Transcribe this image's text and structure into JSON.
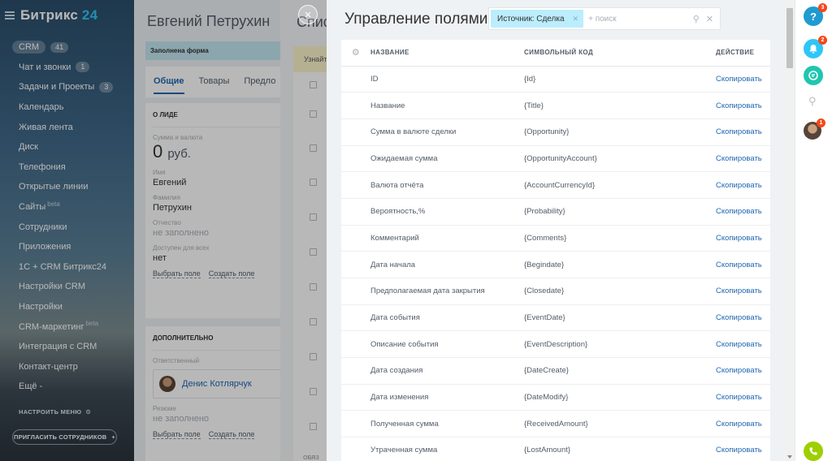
{
  "sidebar": {
    "logo_prefix": "Битрикс",
    "logo_suffix": "24",
    "crm": {
      "label": "CRM",
      "count": "41"
    },
    "items": [
      {
        "label": "Чат и звонки",
        "count": "1"
      },
      {
        "label": "Задачи и Проекты",
        "count": "3"
      },
      {
        "label": "Календарь"
      },
      {
        "label": "Живая лента"
      },
      {
        "label": "Диск"
      },
      {
        "label": "Телефония"
      },
      {
        "label": "Открытые линии"
      },
      {
        "label": "Сайты",
        "sup": "beta"
      },
      {
        "label": "Сотрудники"
      },
      {
        "label": "Приложения"
      },
      {
        "label": "1С + CRM Битрикс24"
      },
      {
        "label": "Настройки CRM"
      },
      {
        "label": "Настройки"
      },
      {
        "label": "CRM-маркетинг",
        "sup": "beta"
      },
      {
        "label": "Интеграция с CRM"
      },
      {
        "label": "Контакт-центр"
      },
      {
        "label": "Ещё -"
      }
    ],
    "settings_menu": "НАСТРОИТЬ МЕНЮ",
    "invite": "ПРИГЛАСИТЬ СОТРУДНИКОВ"
  },
  "contact_card": {
    "title": "Евгений Петрухин",
    "form_bar": "Заполнена форма",
    "tabs": [
      "Общие",
      "Товары",
      "Предло"
    ],
    "about": {
      "section": "О ЛИДЕ",
      "amount_label": "Сумма и валюта",
      "amount_value": "0",
      "amount_currency": "руб.",
      "name_label": "Имя",
      "name_value": "Евгений",
      "lastname_label": "Фамилия",
      "lastname_value": "Петрухин",
      "middle_label": "Отчество",
      "middle_value": "не заполнено",
      "available_label": "Доступен для всех",
      "available_value": "нет",
      "select_field": "Выбрать поле",
      "create_field": "Создать поле"
    },
    "extra": {
      "section": "ДОПОЛНИТЕЛЬНО",
      "responsible_label": "Ответственный",
      "responsible_name": "Денис Котлярчук",
      "resume_label": "Резюме",
      "resume_value": "не заполнено",
      "select_field": "Выбрать поле",
      "create_field": "Создать поле"
    }
  },
  "mid_layer": {
    "title": "Спис",
    "bar_text": "Узнайт",
    "footer": "ОБЯЗ"
  },
  "panel": {
    "title": "Управление полями",
    "filter": {
      "chip": "Источник: Сделка",
      "placeholder": "+ поиск"
    },
    "columns": [
      "НАЗВАНИЕ",
      "СИМВОЛЬНЫЙ КОД",
      "ДЕЙСТВИЕ"
    ],
    "rows": [
      {
        "name": "ID",
        "code": "{Id}",
        "action": "Скопировать"
      },
      {
        "name": "Название",
        "code": "{Title}",
        "action": "Скопировать"
      },
      {
        "name": "Сумма в валюте сделки",
        "code": "{Opportunity}",
        "action": "Скопировать"
      },
      {
        "name": "Ожидаемая сумма",
        "code": "{OpportunityAccount}",
        "action": "Скопировать"
      },
      {
        "name": "Валюта отчёта",
        "code": "{AccountCurrencyId}",
        "action": "Скопировать"
      },
      {
        "name": "Вероятность,%",
        "code": "{Probability}",
        "action": "Скопировать"
      },
      {
        "name": "Комментарий",
        "code": "{Comments}",
        "action": "Скопировать"
      },
      {
        "name": "Дата начала",
        "code": "{Begindate}",
        "action": "Скопировать"
      },
      {
        "name": "Предполагаемая дата закрытия",
        "code": "{Closedate}",
        "action": "Скопировать"
      },
      {
        "name": "Дата события",
        "code": "{EventDate}",
        "action": "Скопировать"
      },
      {
        "name": "Описание события",
        "code": "{EventDescription}",
        "action": "Скопировать"
      },
      {
        "name": "Дата создания",
        "code": "{DateCreate}",
        "action": "Скопировать"
      },
      {
        "name": "Дата изменения",
        "code": "{DateModify}",
        "action": "Скопировать"
      },
      {
        "name": "Полученная сумма",
        "code": "{ReceivedAmount}",
        "action": "Скопировать"
      },
      {
        "name": "Утраченная сумма",
        "code": "{LostAmount}",
        "action": "Скопировать"
      }
    ]
  },
  "rightbar": {
    "help_badge": "3",
    "notify_badge": "2",
    "avatar_badge": "1"
  },
  "colors": {
    "accent": "#2067b0",
    "chip": "#bcedfc",
    "badge": "#f54819",
    "help": "#1f9bd1",
    "notify": "#2fc6f6",
    "chat": "#1ec6b0",
    "phone": "#9dcf00"
  }
}
